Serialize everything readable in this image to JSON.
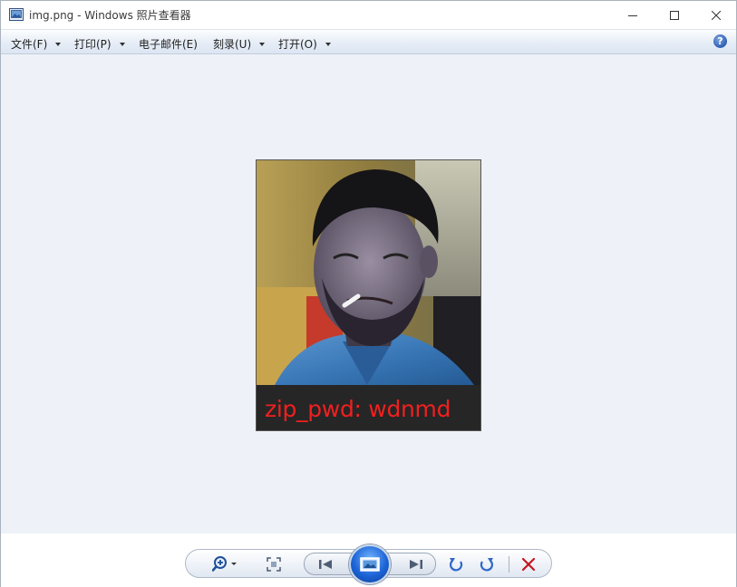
{
  "window": {
    "title": "img.png - Windows 照片查看器",
    "controls": {
      "minimize_icon": "minimize-icon",
      "maximize_icon": "maximize-icon",
      "close_icon": "close-icon"
    }
  },
  "menu": {
    "items": [
      {
        "label": "文件(F)",
        "has_dropdown": true
      },
      {
        "label": "打印(P)",
        "has_dropdown": true
      },
      {
        "label": "电子邮件(E)",
        "has_dropdown": false
      },
      {
        "label": "刻录(U)",
        "has_dropdown": true
      },
      {
        "label": "打开(O)",
        "has_dropdown": true
      }
    ],
    "help_glyph": "?"
  },
  "image": {
    "caption": "zip_pwd: wdnmd",
    "caption_color": "#f21f1f"
  },
  "toolbar": {
    "icons": [
      "zoom-icon",
      "actual-size-icon",
      "previous-icon",
      "slideshow-icon",
      "next-icon",
      "rotate-counterclockwise-icon",
      "rotate-clockwise-icon",
      "delete-icon"
    ]
  },
  "colors": {
    "viewer_background": "#eef2f8",
    "menubar": "#e6edf7",
    "delete_red": "#c4161c",
    "rotate_blue": "#2f68c7"
  }
}
